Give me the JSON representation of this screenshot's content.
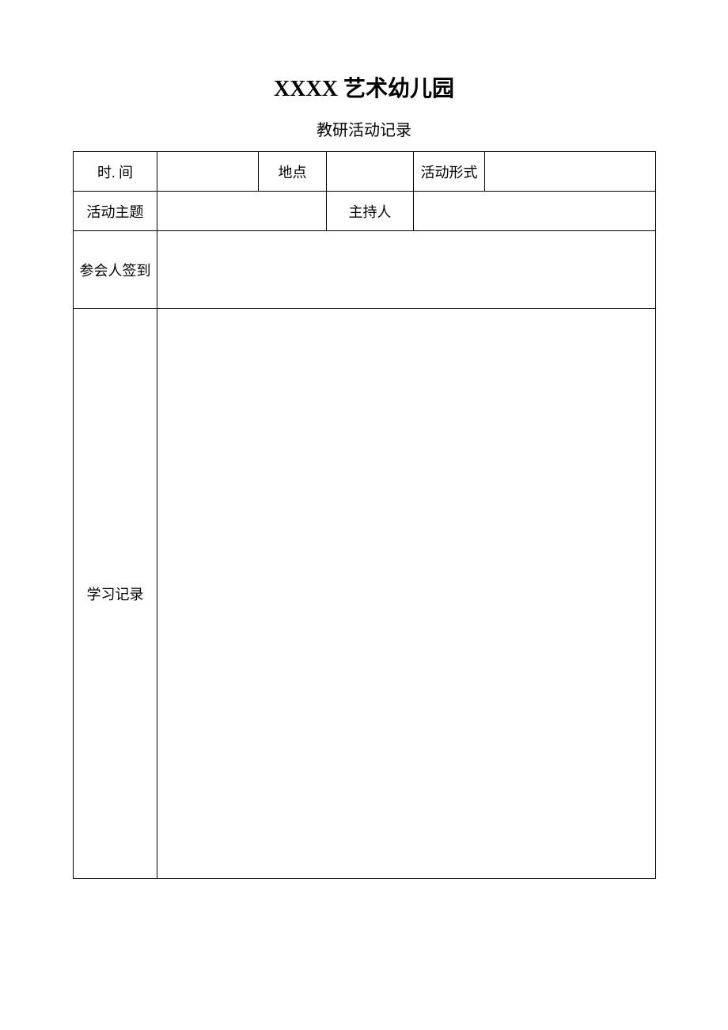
{
  "title_prefix": "XXXX",
  "title_suffix": " 艺术幼儿园",
  "subtitle": "教研活动记录",
  "row1": {
    "label_time": "时. 间",
    "value_time": "",
    "label_place": "地点",
    "value_place": "",
    "label_format": "活动形式",
    "value_format": ""
  },
  "row2": {
    "label_topic": "活动主题",
    "value_topic": "",
    "label_host": "主持人",
    "value_host": ""
  },
  "row3": {
    "label_attendees": "参会人签到",
    "value_attendees": ""
  },
  "row4": {
    "label_record": "学习记录",
    "value_record": ""
  }
}
